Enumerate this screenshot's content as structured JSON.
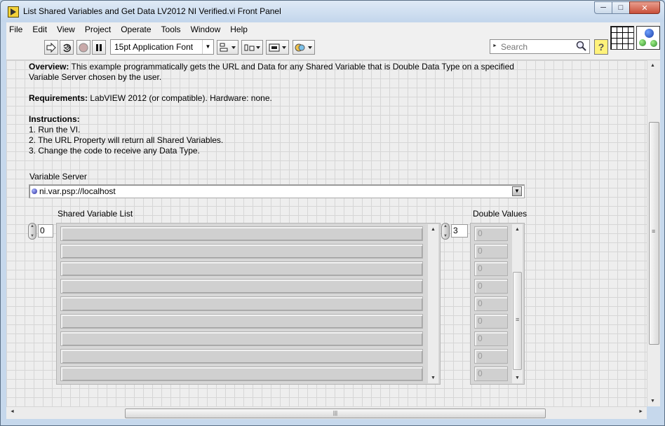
{
  "window": {
    "title": "List Shared Variables and Get Data LV2012 NI Verified.vi Front Panel",
    "minimize": "─",
    "maximize": "□",
    "close": "✕"
  },
  "menu": [
    "File",
    "Edit",
    "View",
    "Project",
    "Operate",
    "Tools",
    "Window",
    "Help"
  ],
  "toolbar": {
    "font": "15pt Application Font",
    "search_placeholder": "Search",
    "help": "?",
    "icons": [
      "run-arrow-icon",
      "run-continuously-icon",
      "abort-icon",
      "pause-icon",
      "align-objects-icon",
      "distribute-objects-icon",
      "resize-objects-icon",
      "reorder-icon"
    ]
  },
  "description": {
    "overview_label": "Overview:",
    "overview_text": " This example programmatically gets the URL and Data for any Shared Variable that is Double Data Type on a specified",
    "overview_text2": "Variable Server chosen by the user.",
    "requirements_label": "Requirements:",
    "requirements_text": " LabVIEW 2012 (or compatible). Hardware: none.",
    "instructions_label": "Instructions:",
    "steps": [
      "1. Run the VI.",
      "2. The URL Property will return all Shared Variables.",
      "3. Change the code to receive any Data Type."
    ]
  },
  "variable_server": {
    "label": "Variable Server",
    "value": "ni.var.psp://localhost"
  },
  "shared_variable_list": {
    "label": "Shared Variable List",
    "index": "0",
    "elements": [
      "",
      "",
      "",
      "",
      "",
      "",
      "",
      "",
      ""
    ]
  },
  "double_values": {
    "label": "Double Values",
    "index": "3",
    "elements": [
      "0",
      "0",
      "0",
      "0",
      "0",
      "0",
      "0",
      "0",
      "0"
    ]
  },
  "colors": {
    "panel_bg": "#eeeeee",
    "grid": "#d6d6d6",
    "frame": "#c6d8ec"
  }
}
